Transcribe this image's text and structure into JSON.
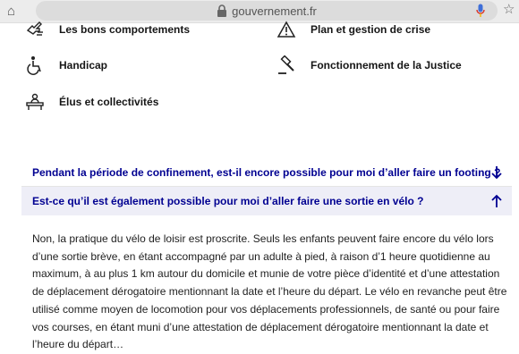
{
  "browser": {
    "url": "gouvernement.fr"
  },
  "categories": [
    {
      "label": "Les bons comportements",
      "icon": "hand-icon"
    },
    {
      "label": "Plan et gestion de crise",
      "icon": "warning-icon"
    },
    {
      "label": "Handicap",
      "icon": "wheelchair-icon"
    },
    {
      "label": "Fonctionnement de la Justice",
      "icon": "gavel-icon"
    },
    {
      "label": "Élus et collectivités",
      "icon": "officials-icon"
    }
  ],
  "faq": [
    {
      "question": "Pendant la période de confinement, est-il encore possible pour moi d’aller faire un footing ?",
      "expanded": false
    },
    {
      "question": "Est-ce qu’il est également possible pour moi d’aller faire une sortie en vélo ?",
      "expanded": true,
      "answer": "Non, la pratique du vélo de loisir est proscrite. Seuls les enfants peuvent faire encore du vélo lors d’une sortie brève, en étant accompagné par un adulte à pied, à raison d’1 heure quotidienne au maximum, à au plus 1 km autour du domicile et munie de votre pièce d’identité et d’une attestation de déplacement dérogatoire mentionnant la date et l’heure du départ. Le vélo en revanche peut être utilisé comme moyen de locomotion pour vos déplacements professionnels, de santé ou pour faire vos courses, en étant muni d’une attestation de déplacement dérogatoire mentionnant la date et l’heure du départ…"
    }
  ],
  "colors": {
    "link_blue": "#000091",
    "expanded_bg": "#eeeef7",
    "mic_accent": "#3f6fd8"
  }
}
